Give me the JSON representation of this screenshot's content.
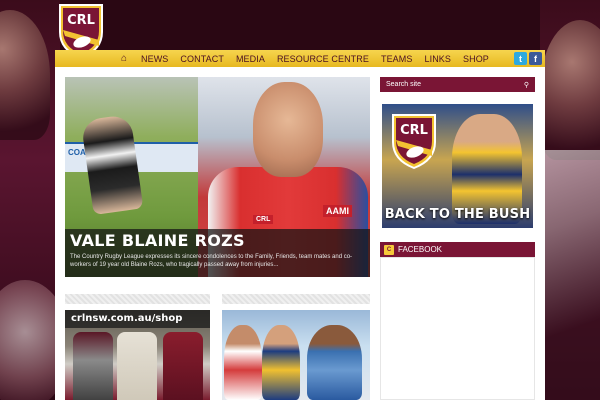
{
  "brand": {
    "logo_text": "CRL"
  },
  "nav": {
    "home_icon": "home-icon",
    "items": [
      "NEWS",
      "CONTACT",
      "MEDIA",
      "RESOURCE CENTRE",
      "TEAMS",
      "LINKS",
      "SHOP"
    ],
    "social": [
      "twitter-icon",
      "facebook-icon"
    ]
  },
  "hero": {
    "banner_text": "COASTWIDE",
    "badge_crl": "CRL",
    "badge_aami": "AAMI",
    "title": "VALE BLAINE ROZS",
    "excerpt": "The Country Rugby League expresses its sincere condolences to the Family, Friends, team mates and co-workers of 19 year old Blaine Rozs, who tragically passed away from injuries..."
  },
  "sidebar": {
    "search_placeholder": "Search site",
    "promo_title": "BACK TO THE BUSH",
    "promo_logo_text": "CRL",
    "facebook_label": "FACEBOOK"
  },
  "tiles": {
    "shop_label": "crlnsw.com.au/shop"
  },
  "colors": {
    "maroon": "#7a1535",
    "gold": "#f6d54e"
  }
}
